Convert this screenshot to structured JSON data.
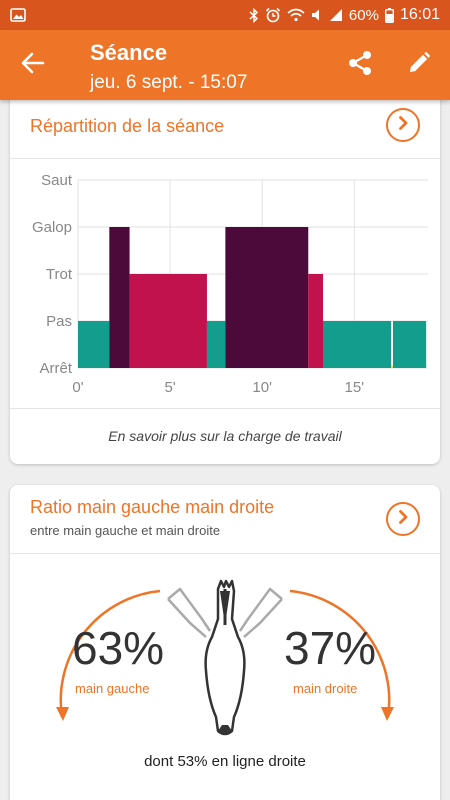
{
  "status_bar": {
    "battery": "60%",
    "time": "16:01",
    "icons": [
      "gallery-icon",
      "bluetooth-icon",
      "alarm-icon",
      "wifi-icon",
      "mute-icon",
      "signal-icon",
      "battery-icon"
    ]
  },
  "header": {
    "title": "Séance",
    "subtitle": "jeu. 6 sept. - 15:07",
    "back_icon": "arrow-back-icon",
    "share_icon": "share-icon",
    "edit_icon": "edit-pencil-icon"
  },
  "repartition_card": {
    "title": "Répartition de la séance",
    "link": "En savoir plus sur la charge de travail"
  },
  "chart_data": {
    "type": "bar",
    "title": "Répartition de la séance",
    "y_categories": [
      "Arrêt",
      "Pas",
      "Trot",
      "Galop",
      "Saut"
    ],
    "x_ticks": [
      "0'",
      "5'",
      "10'",
      "15'"
    ],
    "xlim": [
      0,
      19
    ],
    "grid": true,
    "segments": [
      {
        "start": 0.0,
        "end": 1.7,
        "level": "Pas",
        "color": "#129d8c"
      },
      {
        "start": 1.7,
        "end": 2.8,
        "level": "Galop",
        "color": "#4b0a3a"
      },
      {
        "start": 2.8,
        "end": 7.0,
        "level": "Trot",
        "color": "#c2124e"
      },
      {
        "start": 7.0,
        "end": 8.0,
        "level": "Pas",
        "color": "#129d8c"
      },
      {
        "start": 8.0,
        "end": 12.5,
        "level": "Galop",
        "color": "#4b0a3a"
      },
      {
        "start": 12.5,
        "end": 13.3,
        "level": "Trot",
        "color": "#c2124e"
      },
      {
        "start": 13.3,
        "end": 17.0,
        "level": "Pas",
        "color": "#129d8c"
      },
      {
        "start": 17.0,
        "end": 17.1,
        "level": "Arrêt",
        "color": "#e6d84a"
      },
      {
        "start": 17.1,
        "end": 18.9,
        "level": "Pas",
        "color": "#129d8c"
      }
    ]
  },
  "ratio_card": {
    "title": "Ratio main gauche main droite",
    "subtitle": "entre main gauche et main droite",
    "left_value": "63%",
    "left_label": "main gauche",
    "right_value": "37%",
    "right_label": "main droite",
    "straight_line": "dont 53% en ligne droite"
  },
  "colors": {
    "accent": "#ee7427",
    "status_bar": "#d8561e"
  }
}
